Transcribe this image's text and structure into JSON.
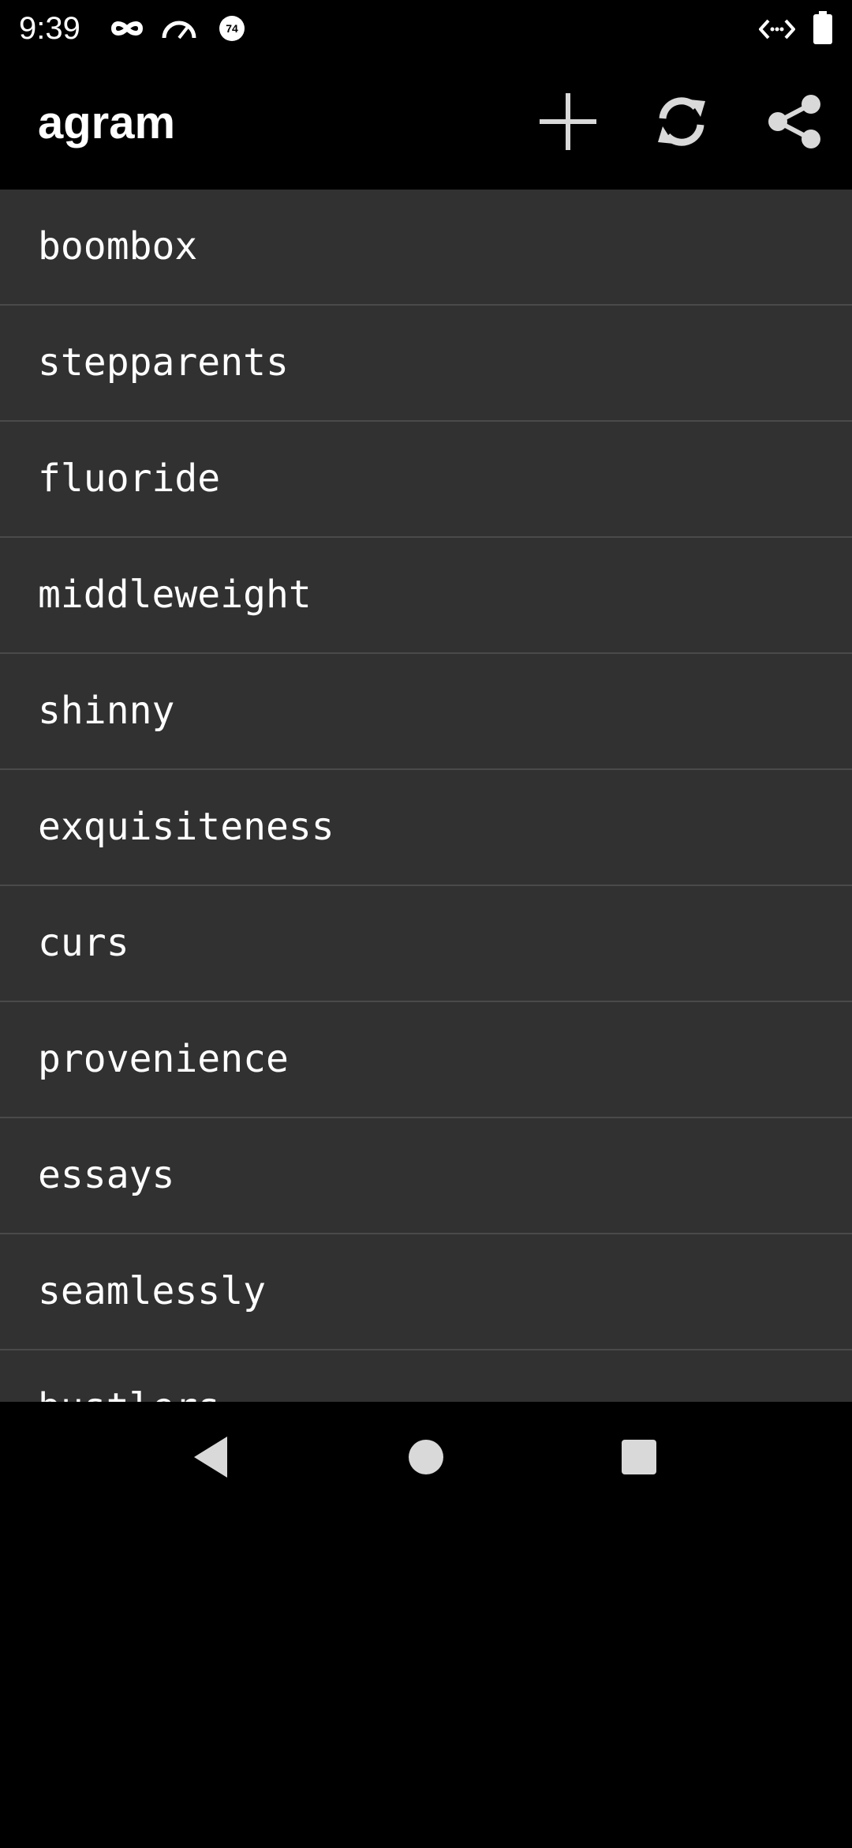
{
  "status_bar": {
    "time": "9:39",
    "icons": [
      "incognito-icon",
      "speedometer-icon",
      "notification-74-icon",
      "code-icon",
      "battery-icon"
    ],
    "badge_number": "74"
  },
  "app_bar": {
    "title": "agram",
    "actions": [
      {
        "name": "add",
        "icon": "plus-icon"
      },
      {
        "name": "refresh",
        "icon": "refresh-icon"
      },
      {
        "name": "share",
        "icon": "share-icon"
      }
    ]
  },
  "words": [
    "boombox",
    "stepparents",
    "fluoride",
    "middleweight",
    "shinny",
    "exquisiteness",
    "curs",
    "provenience",
    "essays",
    "seamlessly",
    "bustlers"
  ],
  "nav_bar": {
    "buttons": [
      "back-icon",
      "home-icon",
      "recents-icon"
    ]
  },
  "colors": {
    "background": "#000000",
    "list_background": "#313131",
    "divider": "#4a4a4a",
    "text": "#ffffff",
    "icon": "#d9d9d9"
  }
}
